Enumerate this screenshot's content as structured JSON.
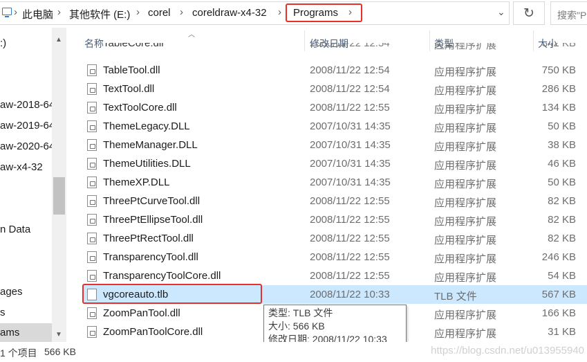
{
  "address": {
    "crumbs": [
      "此电脑",
      "其他软件 (E:)",
      "corel",
      "coreldraw-x4-32",
      "Programs"
    ],
    "refresh_icon": "refresh-icon",
    "dropdown_icon": "chevron-down-icon",
    "search_placeholder": "搜索\"P"
  },
  "nav": {
    "items": [
      ":)",
      "aw-2018-64",
      "aw-2019-64",
      "aw-2020-64",
      "aw-x4-32",
      "n Data",
      "ages",
      "s",
      "ams"
    ]
  },
  "columns": {
    "name": "名称",
    "date": "修改日期",
    "type": "类型",
    "size": "大小"
  },
  "files": [
    {
      "name": "TableCore.dll",
      "date": "2008/11/22 12:54",
      "type": "应用程序扩展",
      "size": "342 KB"
    },
    {
      "name": "TableTool.dll",
      "date": "2008/11/22 12:54",
      "type": "应用程序扩展",
      "size": "750 KB"
    },
    {
      "name": "TextTool.dll",
      "date": "2008/11/22 12:54",
      "type": "应用程序扩展",
      "size": "286 KB"
    },
    {
      "name": "TextToolCore.dll",
      "date": "2008/11/22 12:55",
      "type": "应用程序扩展",
      "size": "134 KB"
    },
    {
      "name": "ThemeLegacy.DLL",
      "date": "2007/10/31 14:35",
      "type": "应用程序扩展",
      "size": "50 KB"
    },
    {
      "name": "ThemeManager.DLL",
      "date": "2007/10/31 14:35",
      "type": "应用程序扩展",
      "size": "38 KB"
    },
    {
      "name": "ThemeUtilities.DLL",
      "date": "2007/10/31 14:35",
      "type": "应用程序扩展",
      "size": "46 KB"
    },
    {
      "name": "ThemeXP.DLL",
      "date": "2007/10/31 14:35",
      "type": "应用程序扩展",
      "size": "50 KB"
    },
    {
      "name": "ThreePtCurveTool.dll",
      "date": "2008/11/22 12:55",
      "type": "应用程序扩展",
      "size": "82 KB"
    },
    {
      "name": "ThreePtEllipseTool.dll",
      "date": "2008/11/22 12:55",
      "type": "应用程序扩展",
      "size": "82 KB"
    },
    {
      "name": "ThreePtRectTool.dll",
      "date": "2008/11/22 12:55",
      "type": "应用程序扩展",
      "size": "82 KB"
    },
    {
      "name": "TransparencyTool.dll",
      "date": "2008/11/22 12:55",
      "type": "应用程序扩展",
      "size": "246 KB"
    },
    {
      "name": "TransparencyToolCore.dll",
      "date": "2008/11/22 12:55",
      "type": "应用程序扩展",
      "size": "54 KB"
    },
    {
      "name": "vgcoreauto.tlb",
      "date": "2008/11/22 10:33",
      "type": "TLB 文件",
      "size": "567 KB"
    },
    {
      "name": "ZoomPanTool.dll",
      "date": "",
      "type": "应用程序扩展",
      "size": "166 KB"
    },
    {
      "name": "ZoomPanToolCore.dll",
      "date": "",
      "type": "应用程序扩展",
      "size": "31 KB"
    }
  ],
  "tooltip": {
    "type_line": "类型: TLB 文件",
    "size_line": "大小: 566 KB",
    "date_line": "修改日期: 2008/11/22 10:33"
  },
  "status": {
    "selected_count": "1 个项目",
    "selected_size": "566 KB",
    "watermark": "https://blog.csdn.net/u013955940"
  },
  "colors": {
    "highlight_red": "#e8302a",
    "selection_blue": "#cce8ff",
    "header_text": "#4c607a"
  }
}
